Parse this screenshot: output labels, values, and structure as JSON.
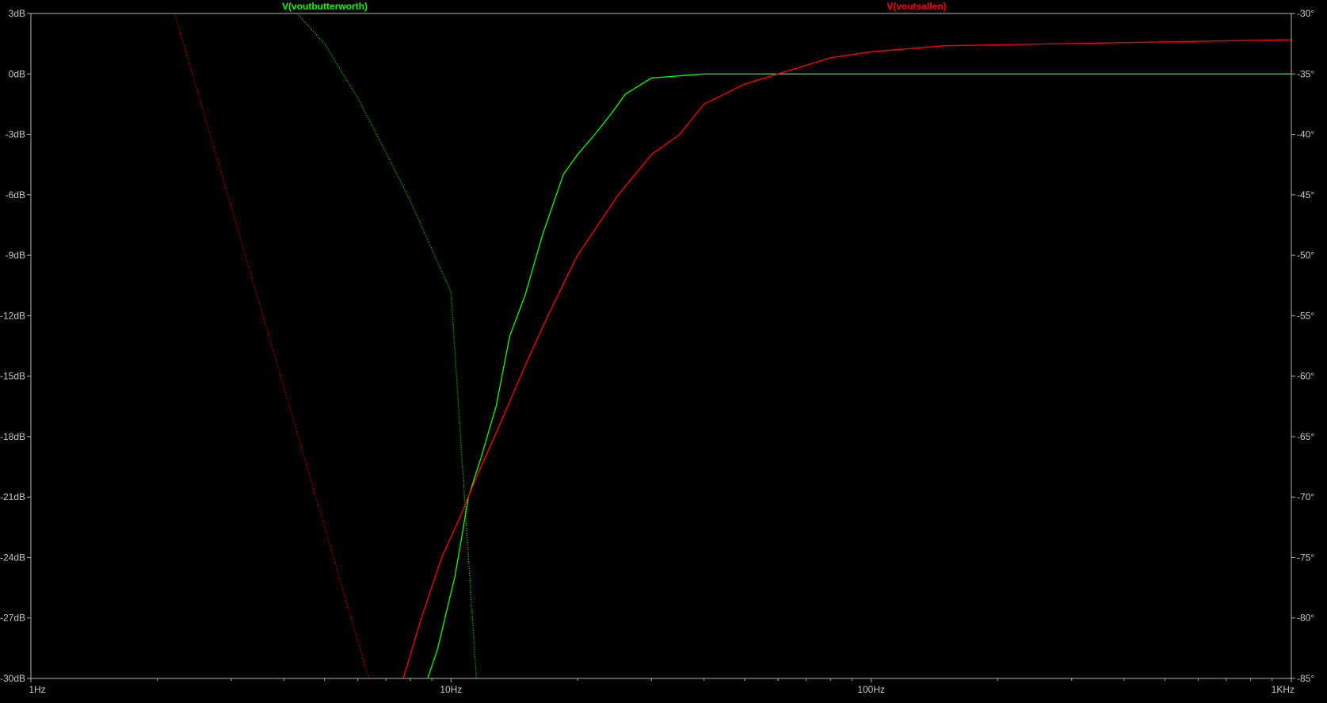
{
  "chart_data": {
    "type": "line",
    "x_scale": "log",
    "xlim": [
      1,
      1000
    ],
    "x_ticks": [
      {
        "value": 1,
        "label": "1Hz"
      },
      {
        "value": 10,
        "label": "10Hz"
      },
      {
        "value": 100,
        "label": "100Hz"
      },
      {
        "value": 1000,
        "label": "1KHz"
      }
    ],
    "y_left": {
      "range": [
        -30,
        3
      ],
      "ticks": [
        {
          "value": 3,
          "label": "3dB"
        },
        {
          "value": 0,
          "label": "0dB"
        },
        {
          "value": -3,
          "label": "-3dB"
        },
        {
          "value": -6,
          "label": "-6dB"
        },
        {
          "value": -9,
          "label": "-9dB"
        },
        {
          "value": -12,
          "label": "-12dB"
        },
        {
          "value": -15,
          "label": "-15dB"
        },
        {
          "value": -18,
          "label": "-18dB"
        },
        {
          "value": -21,
          "label": "-21dB"
        },
        {
          "value": -24,
          "label": "-24dB"
        },
        {
          "value": -27,
          "label": "-27dB"
        },
        {
          "value": -30,
          "label": "-30dB"
        }
      ]
    },
    "y_right": {
      "range": [
        -85,
        -30
      ],
      "ticks": [
        {
          "value": -30,
          "label": "-30°"
        },
        {
          "value": -35,
          "label": "-35°"
        },
        {
          "value": -40,
          "label": "-40°"
        },
        {
          "value": -45,
          "label": "-45°"
        },
        {
          "value": -50,
          "label": "-50°"
        },
        {
          "value": -55,
          "label": "-55°"
        },
        {
          "value": -60,
          "label": "-60°"
        },
        {
          "value": -65,
          "label": "-65°"
        },
        {
          "value": -70,
          "label": "-70°"
        },
        {
          "value": -75,
          "label": "-75°"
        },
        {
          "value": -80,
          "label": "-80°"
        },
        {
          "value": -85,
          "label": "-85°"
        }
      ]
    },
    "grid": false,
    "legend_position": "top",
    "series": [
      {
        "name": "V(voutbutterworth)",
        "color": "#00ff00",
        "magnitude": [
          [
            8.8,
            -30
          ],
          [
            9.3,
            -28.5
          ],
          [
            9.8,
            -26.5
          ],
          [
            10.2,
            -25
          ],
          [
            10.4,
            -24
          ],
          [
            11,
            -21
          ],
          [
            11.8,
            -19
          ],
          [
            12.8,
            -16.5
          ],
          [
            13.8,
            -13
          ],
          [
            15,
            -11
          ],
          [
            16.5,
            -8
          ],
          [
            18.5,
            -5
          ],
          [
            20,
            -4
          ],
          [
            22,
            -3
          ],
          [
            24,
            -2
          ],
          [
            26,
            -1
          ],
          [
            30,
            -0.2
          ],
          [
            40,
            0
          ],
          [
            1000,
            0
          ]
        ],
        "phase": [
          [
            4.3,
            -30
          ],
          [
            5,
            -32.5
          ],
          [
            6,
            -37
          ],
          [
            7,
            -41.5
          ],
          [
            8,
            -45.5
          ],
          [
            9,
            -49.5
          ],
          [
            10,
            -53
          ],
          [
            11.5,
            -85.2
          ]
        ]
      },
      {
        "name": "V(voutsallen)",
        "color": "#ff0000",
        "magnitude": [
          [
            7.7,
            -30
          ],
          [
            8.5,
            -27
          ],
          [
            9.5,
            -24
          ],
          [
            10.5,
            -22
          ],
          [
            11.5,
            -20
          ],
          [
            13,
            -17.5
          ],
          [
            15,
            -14.5
          ],
          [
            17,
            -12
          ],
          [
            20,
            -9
          ],
          [
            25,
            -6
          ],
          [
            30,
            -4
          ],
          [
            35,
            -3
          ],
          [
            40,
            -1.5
          ],
          [
            50,
            -0.5
          ],
          [
            60,
            0
          ],
          [
            80,
            0.8
          ],
          [
            100,
            1.1
          ],
          [
            150,
            1.4
          ],
          [
            1000,
            1.7
          ]
        ],
        "phase": [
          [
            2.2,
            -30
          ],
          [
            6.4,
            -85.2
          ]
        ]
      }
    ]
  }
}
